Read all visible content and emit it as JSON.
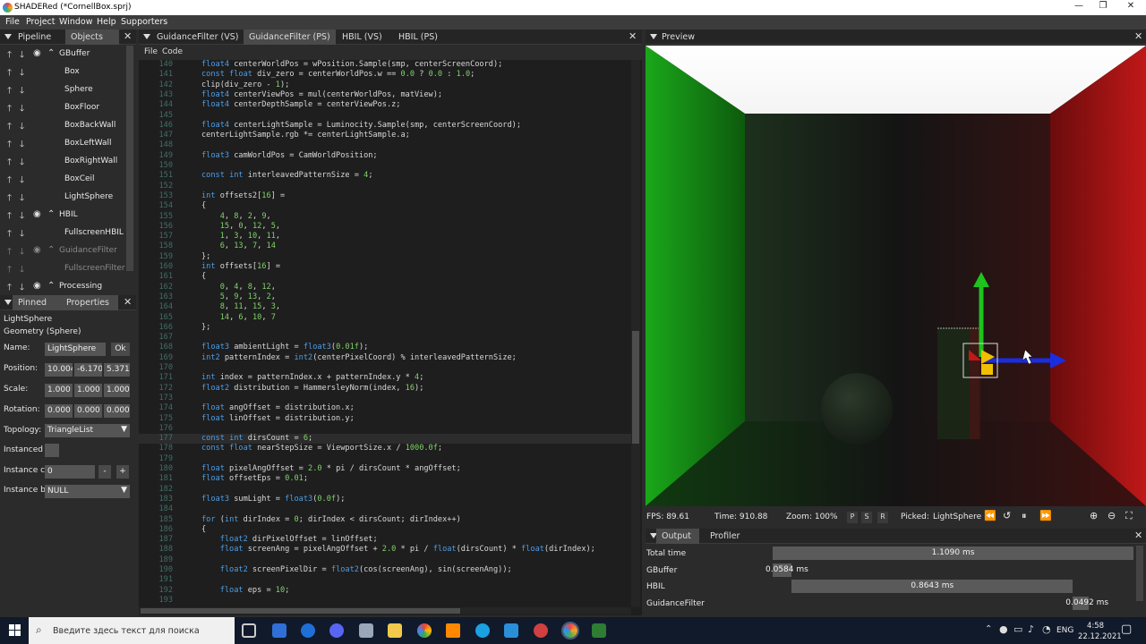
{
  "window": {
    "title": "SHADERed (*CornellBox.sprj)",
    "controls": [
      "—",
      "❐",
      "✕"
    ]
  },
  "menu": [
    "File",
    "Project",
    "Window",
    "Help",
    "Supporters"
  ],
  "left_tabs": {
    "pipeline": "Pipeline",
    "objects": "Objects"
  },
  "pipeline": [
    {
      "label": "GBuffer",
      "level": 0,
      "eye": true,
      "collapse": true
    },
    {
      "label": "Box",
      "level": 1
    },
    {
      "label": "Sphere",
      "level": 1
    },
    {
      "label": "BoxFloor",
      "level": 1
    },
    {
      "label": "BoxBackWall",
      "level": 1
    },
    {
      "label": "BoxLeftWall",
      "level": 1
    },
    {
      "label": "BoxRightWall",
      "level": 1
    },
    {
      "label": "BoxCeil",
      "level": 1
    },
    {
      "label": "LightSphere",
      "level": 1
    },
    {
      "label": "HBIL",
      "level": 0,
      "eye": true,
      "collapse": true
    },
    {
      "label": "FullscreenHBIL",
      "level": 1
    },
    {
      "label": "GuidanceFilter",
      "level": 0,
      "eye": true,
      "collapse": true,
      "dim": true
    },
    {
      "label": "FullscreenFilter",
      "level": 1,
      "dim": true
    },
    {
      "label": "Processing",
      "level": 0,
      "eye": true,
      "collapse": true
    }
  ],
  "props_tabs": {
    "pinned": "Pinned",
    "properties": "Properties"
  },
  "props": {
    "object_name": "LightSphere",
    "object_type": "Geometry (Sphere)",
    "name_label": "Name:",
    "name_value": "LightSphere",
    "ok": "Ok",
    "position_label": "Position:",
    "position": [
      "10.004",
      "-6.170",
      "5.371"
    ],
    "scale_label": "Scale:",
    "scale": [
      "1.000",
      "1.000",
      "1.000"
    ],
    "rotation_label": "Rotation:",
    "rotation": [
      "0.000",
      "0.000",
      "0.000"
    ],
    "topology_label": "Topology:",
    "topology": "TriangleList",
    "instanced_label": "Instanced",
    "instance_count_label": "Instance c",
    "instance_count": "0",
    "minus": "-",
    "plus": "+",
    "instance_buffer_label": "Instance b",
    "instance_buffer": "NULL"
  },
  "editor_tabs": [
    "GuidanceFilter (VS)",
    "GuidanceFilter (PS)",
    "HBIL (VS)",
    "HBIL (PS)"
  ],
  "editor_menu": [
    "File",
    "Code"
  ],
  "code": [
    {
      "n": "140",
      "t": "float4 centerWorldPos = wPosition.Sample(smp, centerScreenCoord);"
    },
    {
      "n": "141",
      "t": "const float div_zero = centerWorldPos.w == 0.0 ? 0.0 : 1.0;"
    },
    {
      "n": "142",
      "t": "clip(div_zero - 1);"
    },
    {
      "n": "143",
      "t": "float4 centerViewPos = mul(centerWorldPos, matView);"
    },
    {
      "n": "144",
      "t": "float4 centerDepthSample = centerViewPos.z;"
    },
    {
      "n": "145",
      "t": ""
    },
    {
      "n": "146",
      "t": "float4 centerLightSample = Luminocity.Sample(smp, centerScreenCoord);"
    },
    {
      "n": "147",
      "t": "centerLightSample.rgb *= centerLightSample.a;"
    },
    {
      "n": "148",
      "t": ""
    },
    {
      "n": "149",
      "t": "float3 camWorldPos = CamWorldPosition;"
    },
    {
      "n": "150",
      "t": ""
    },
    {
      "n": "151",
      "t": "const int interleavedPatternSize = 4;"
    },
    {
      "n": "152",
      "t": ""
    },
    {
      "n": "153",
      "t": "int offsets2[16] ="
    },
    {
      "n": "154",
      "t": "{"
    },
    {
      "n": "155",
      "t": "    4, 8, 2, 9,"
    },
    {
      "n": "156",
      "t": "    15, 0, 12, 5,"
    },
    {
      "n": "157",
      "t": "    1, 3, 10, 11,"
    },
    {
      "n": "158",
      "t": "    6, 13, 7, 14"
    },
    {
      "n": "159",
      "t": "};"
    },
    {
      "n": "160",
      "t": "int offsets[16] ="
    },
    {
      "n": "161",
      "t": "{"
    },
    {
      "n": "162",
      "t": "    0, 4, 8, 12,"
    },
    {
      "n": "163",
      "t": "    5, 9, 13, 2,"
    },
    {
      "n": "164",
      "t": "    8, 11, 15, 3,"
    },
    {
      "n": "165",
      "t": "    14, 6, 10, 7"
    },
    {
      "n": "166",
      "t": "};"
    },
    {
      "n": "167",
      "t": ""
    },
    {
      "n": "168",
      "t": "float3 ambientLight = float3(0.01f);"
    },
    {
      "n": "169",
      "t": "int2 patternIndex = int2(centerPixelCoord) % interleavedPatternSize;"
    },
    {
      "n": "170",
      "t": ""
    },
    {
      "n": "171",
      "t": "int index = patternIndex.x + patternIndex.y * 4;"
    },
    {
      "n": "172",
      "t": "float2 distribution = HammersleyNorm(index, 16);"
    },
    {
      "n": "173",
      "t": ""
    },
    {
      "n": "174",
      "t": "float angOffset = distribution.x;"
    },
    {
      "n": "175",
      "t": "float linOffset = distribution.y;"
    },
    {
      "n": "176",
      "t": ""
    },
    {
      "n": "177",
      "t": "const int dirsCount = 6;"
    },
    {
      "n": "178",
      "t": "const float nearStepSize = ViewportSize.x / 1000.0f;"
    },
    {
      "n": "179",
      "t": ""
    },
    {
      "n": "180",
      "t": "float pixelAngOffset = 2.0 * pi / dirsCount * angOffset;"
    },
    {
      "n": "181",
      "t": "float offsetEps = 0.01;"
    },
    {
      "n": "182",
      "t": ""
    },
    {
      "n": "183",
      "t": "float3 sumLight = float3(0.0f);"
    },
    {
      "n": "184",
      "t": ""
    },
    {
      "n": "185",
      "t": "for (int dirIndex = 0; dirIndex < dirsCount; dirIndex++)"
    },
    {
      "n": "186",
      "t": "{"
    },
    {
      "n": "187",
      "t": "    float2 dirPixelOffset = linOffset;"
    },
    {
      "n": "188",
      "t": "    float screenAng = pixelAngOffset + 2.0 * pi / float(dirsCount) * float(dirIndex);"
    },
    {
      "n": "189",
      "t": ""
    },
    {
      "n": "190",
      "t": "    float2 screenPixelDir = float2(cos(screenAng), sin(screenAng));"
    },
    {
      "n": "191",
      "t": ""
    },
    {
      "n": "192",
      "t": "    float eps = 10;"
    },
    {
      "n": "193",
      "t": ""
    }
  ],
  "preview_tab": "Preview",
  "status": {
    "fps": "FPS: 89.61",
    "time": "Time: 910.88",
    "zoom": "Zoom: 100%",
    "btn_p": "P",
    "btn_s": "S",
    "btn_r": "R",
    "picked_label": "Picked:",
    "picked": "LightSphere"
  },
  "output_tabs": {
    "output": "Output",
    "profiler": "Profiler"
  },
  "profiler": [
    {
      "name": "Total time",
      "value": "1.1090 ms",
      "start": 0.0,
      "end": 1.0
    },
    {
      "name": "GBuffer",
      "value": "0.0584 ms",
      "start": 0.0,
      "end": 0.053
    },
    {
      "name": "HBIL",
      "value": "0.8643 ms",
      "start": 0.053,
      "end": 0.832
    },
    {
      "name": "GuidanceFilter",
      "value": "0.0492 ms",
      "start": 0.832,
      "end": 0.876
    }
  ],
  "taskbar": {
    "search_placeholder": "Введите здесь текст для поиска",
    "lang": "ENG",
    "time": "4:58",
    "date": "22.12.2021"
  },
  "colors": {
    "accent_green": "#22c022",
    "accent_red": "#d02020",
    "gizmo_blue": "#1a2de0",
    "gizmo_yellow": "#f0c000"
  }
}
